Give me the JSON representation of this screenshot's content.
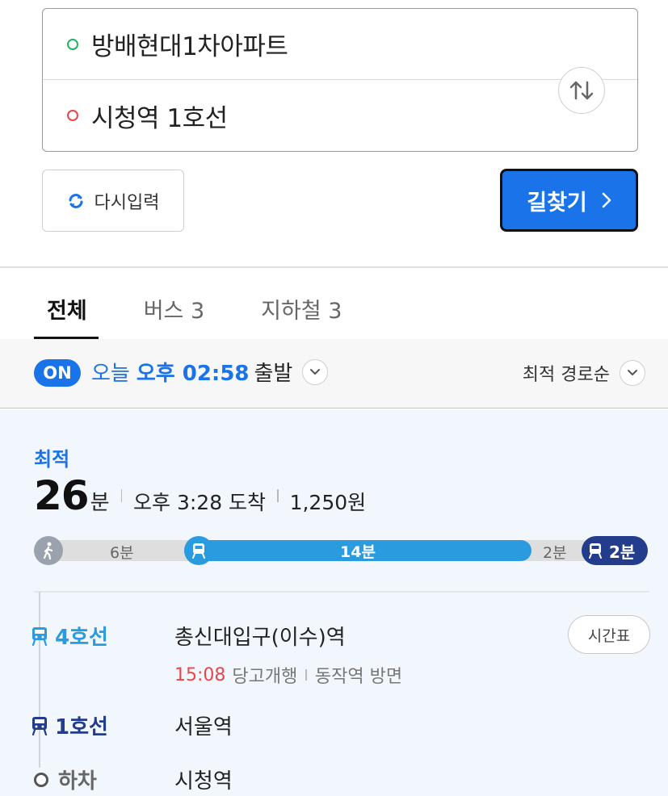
{
  "search": {
    "origin": "방배현대1차아파트",
    "destination": "시청역 1호선",
    "swap_icon": "swap-vertical-icon"
  },
  "actions": {
    "reset_label": "다시입력",
    "find_label": "길찾기",
    "accent": "#1a73e8"
  },
  "tabs": [
    {
      "label": "전체",
      "active": true
    },
    {
      "label": "버스 3",
      "active": false
    },
    {
      "label": "지하철 3",
      "active": false
    }
  ],
  "filter": {
    "on_badge": "ON",
    "day": "오늘",
    "time": "오후 02:58",
    "suffix": "출발",
    "sort_label": "최적 경로순"
  },
  "route": {
    "badge": "최적",
    "duration_num": "26",
    "duration_unit": "분",
    "arrival": "오후 3:28 도착",
    "fare": "1,250원",
    "segments": {
      "walk1": "6분",
      "line4": "14분",
      "walk2": "2분",
      "line1": "2분"
    },
    "steps": [
      {
        "line": "4호선",
        "station": "총신대입구(이수)역",
        "color": "#2b9be0"
      },
      {
        "line": "1호선",
        "station": "서울역",
        "color": "#233d8c"
      },
      {
        "line": "하차",
        "station": "시청역",
        "color": "#666666"
      }
    ],
    "first_step_info": {
      "departure_time": "15:08",
      "train": "당고개행",
      "direction": "동작역 방면"
    },
    "timetable_label": "시간표"
  }
}
